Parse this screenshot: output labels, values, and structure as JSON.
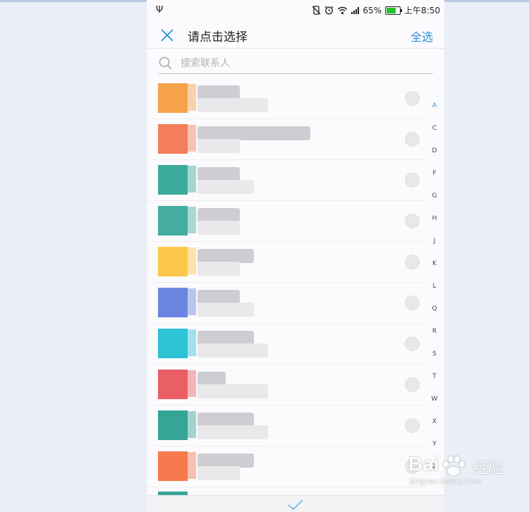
{
  "status_bar": {
    "usb_icon": "usb-icon",
    "battery_percent": "65%",
    "time": "上午8:50",
    "icons": [
      "vibrate-off-icon",
      "alarm-icon",
      "wifi-icon",
      "signal-icon",
      "battery-icon"
    ]
  },
  "header": {
    "close_icon": "close-icon",
    "title": "请点击选择",
    "select_all": "全选"
  },
  "search": {
    "placeholder": "搜索联系人",
    "value": ""
  },
  "contacts": [
    {
      "avatar_color": "#f6a24a",
      "selected": false
    },
    {
      "avatar_color": "#f47d5c",
      "selected": false
    },
    {
      "avatar_color": "#3cab9c",
      "selected": false
    },
    {
      "avatar_color": "#45ad9f",
      "selected": false
    },
    {
      "avatar_color": "#fbc84a",
      "selected": false
    },
    {
      "avatar_color": "#6b86e0",
      "selected": false
    },
    {
      "avatar_color": "#2ec3d6",
      "selected": false
    },
    {
      "avatar_color": "#ea5f66",
      "selected": false
    },
    {
      "avatar_color": "#35a596",
      "selected": false
    },
    {
      "avatar_color": "#f77a4e",
      "selected": false
    }
  ],
  "index_letters": [
    "A",
    "C",
    "D",
    "F",
    "G",
    "H",
    "J",
    "K",
    "L",
    "Q",
    "R",
    "S",
    "T",
    "W",
    "X",
    "Y",
    "Z"
  ],
  "active_letter": "A",
  "bottom": {
    "confirm_icon": "checkmark-icon"
  },
  "watermark": {
    "logo": "Bai",
    "brand": "经验",
    "url": "jingyan.baidu.com"
  },
  "colors": {
    "accent": "#2b91d9",
    "background": "#e9eef7"
  }
}
